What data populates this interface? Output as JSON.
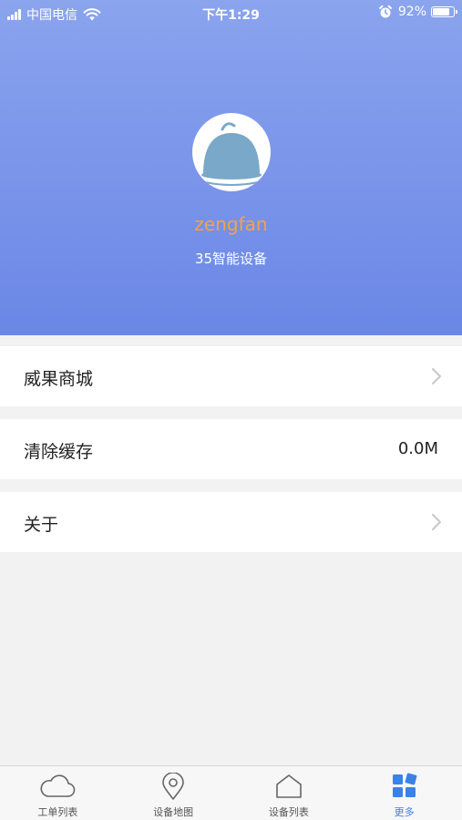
{
  "status_bar": {
    "carrier": "中国电信",
    "time": "下午1:29",
    "battery_percent": "92%",
    "battery_level": 0.92
  },
  "profile": {
    "username": "zengfan",
    "company": "35智能设备"
  },
  "menu": {
    "shop_label": "威果商城",
    "clear_cache_label": "清除缓存",
    "cache_size": "0.0M",
    "about_label": "关于"
  },
  "tabs": [
    {
      "label": "工单列表",
      "icon": "cloud-icon"
    },
    {
      "label": "设备地图",
      "icon": "location-pin-icon"
    },
    {
      "label": "设备列表",
      "icon": "home-icon"
    },
    {
      "label": "更多",
      "icon": "grid-icon"
    }
  ],
  "colors": {
    "header_top": "#8aa4ee",
    "header_bottom": "#6b87e6",
    "username": "#f3a347",
    "active_tab": "#3b82e8",
    "inactive_tab": "#555555"
  },
  "active_tab_index": 3
}
